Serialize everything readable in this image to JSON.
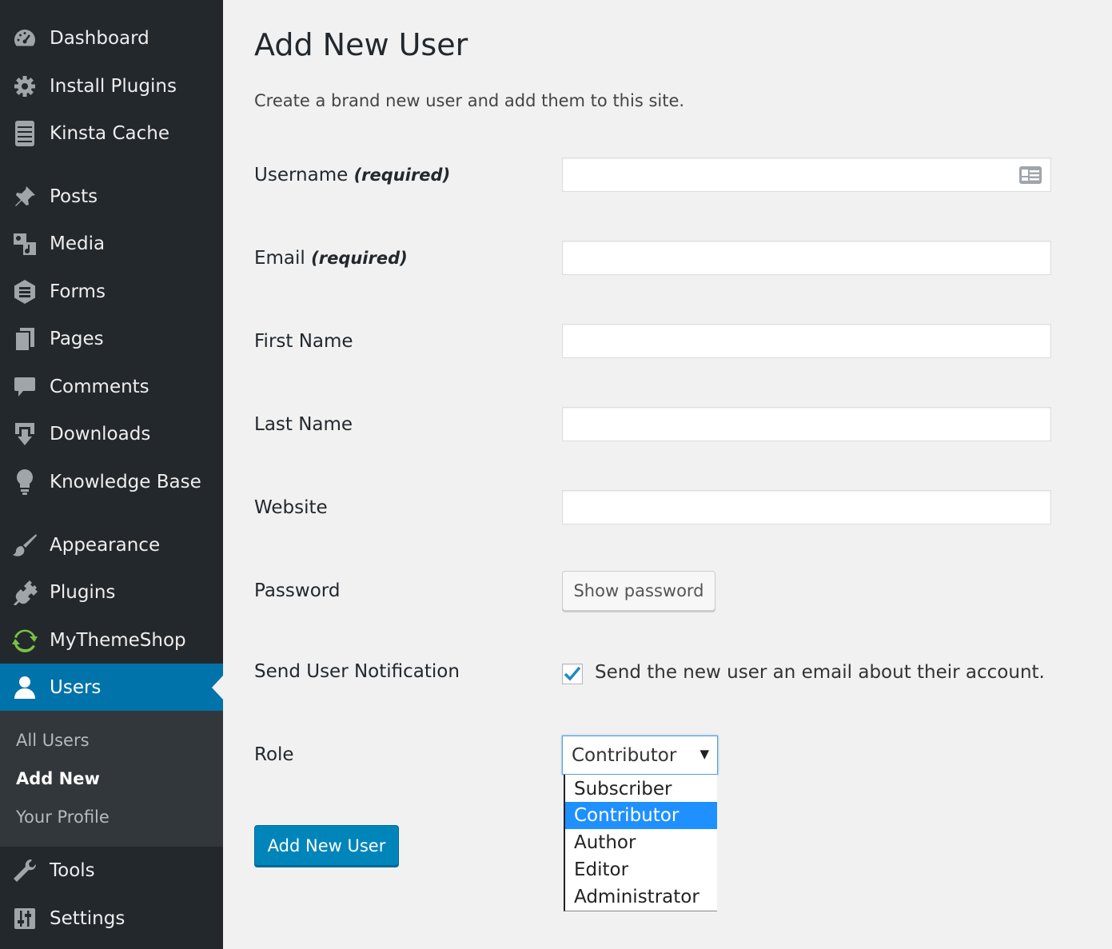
{
  "sidebar": {
    "items": [
      {
        "label": "Dashboard",
        "icon": "dashboard-icon"
      },
      {
        "label": "Install Plugins",
        "icon": "gear-icon"
      },
      {
        "label": "Kinsta Cache",
        "icon": "server-icon"
      },
      {
        "label": "Posts",
        "icon": "pin-icon"
      },
      {
        "label": "Media",
        "icon": "media-icon"
      },
      {
        "label": "Forms",
        "icon": "forms-icon"
      },
      {
        "label": "Pages",
        "icon": "pages-icon"
      },
      {
        "label": "Comments",
        "icon": "comment-icon"
      },
      {
        "label": "Downloads",
        "icon": "download-icon"
      },
      {
        "label": "Knowledge Base",
        "icon": "lightbulb-icon"
      },
      {
        "label": "Appearance",
        "icon": "brush-icon"
      },
      {
        "label": "Plugins",
        "icon": "plug-icon"
      },
      {
        "label": "MyThemeShop",
        "icon": "refresh-icon"
      },
      {
        "label": "Users",
        "icon": "user-icon"
      },
      {
        "label": "Tools",
        "icon": "wrench-icon"
      },
      {
        "label": "Settings",
        "icon": "settings-sliders-icon"
      }
    ],
    "submenu": [
      {
        "label": "All Users"
      },
      {
        "label": "Add New"
      },
      {
        "label": "Your Profile"
      }
    ],
    "active_color": "#0073aa"
  },
  "page": {
    "title": "Add New User",
    "description": "Create a brand new user and add them to this site."
  },
  "form": {
    "username_label": "Username",
    "username_required": "(required)",
    "username_value": "",
    "email_label": "Email",
    "email_required": "(required)",
    "email_value": "",
    "first_name_label": "First Name",
    "first_name_value": "",
    "last_name_label": "Last Name",
    "last_name_value": "",
    "website_label": "Website",
    "website_value": "",
    "password_label": "Password",
    "show_password_label": "Show password",
    "notification_label": "Send User Notification",
    "notification_checked": true,
    "notification_text": "Send the new user an email about their account.",
    "role_label": "Role",
    "role_selected": "Contributor",
    "role_options": [
      "Subscriber",
      "Contributor",
      "Author",
      "Editor",
      "Administrator"
    ],
    "submit_label": "Add New User"
  }
}
